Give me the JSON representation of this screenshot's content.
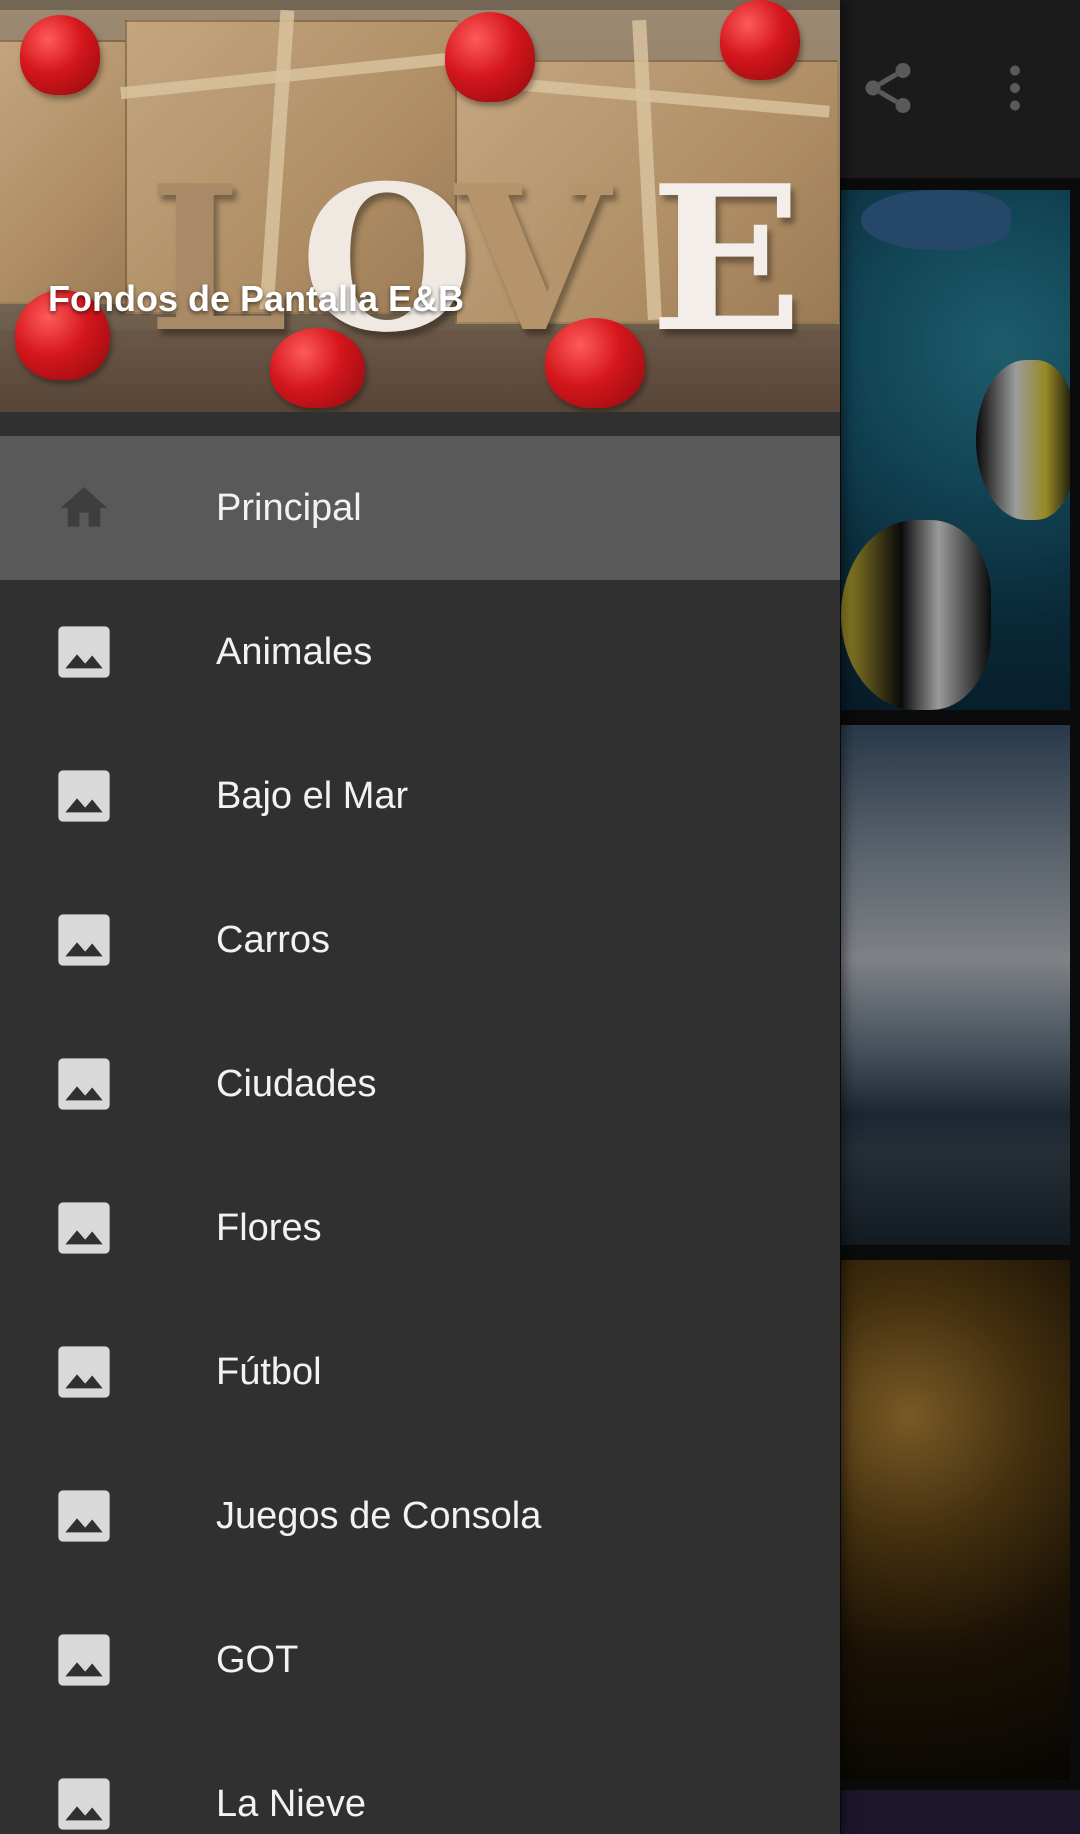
{
  "drawer": {
    "title": "Fondos de Pantalla E&B",
    "header_image_text": "LOVE",
    "items": [
      {
        "label": "Principal",
        "icon": "home-icon",
        "active": true
      },
      {
        "label": "Animales",
        "icon": "image-icon",
        "active": false
      },
      {
        "label": "Bajo el Mar",
        "icon": "image-icon",
        "active": false
      },
      {
        "label": "Carros",
        "icon": "image-icon",
        "active": false
      },
      {
        "label": "Ciudades",
        "icon": "image-icon",
        "active": false
      },
      {
        "label": "Flores",
        "icon": "image-icon",
        "active": false
      },
      {
        "label": "Fútbol",
        "icon": "image-icon",
        "active": false
      },
      {
        "label": "Juegos de Consola",
        "icon": "image-icon",
        "active": false
      },
      {
        "label": "GOT",
        "icon": "image-icon",
        "active": false
      },
      {
        "label": "La Nieve",
        "icon": "image-icon",
        "active": false
      }
    ]
  },
  "app_bar": {
    "actions": [
      "share-icon",
      "more-vert-icon"
    ]
  },
  "colors": {
    "drawer_background": "#303030",
    "active_item_background": "#595959",
    "text": "#f2f2f2",
    "icon": "#d9d9d9"
  }
}
